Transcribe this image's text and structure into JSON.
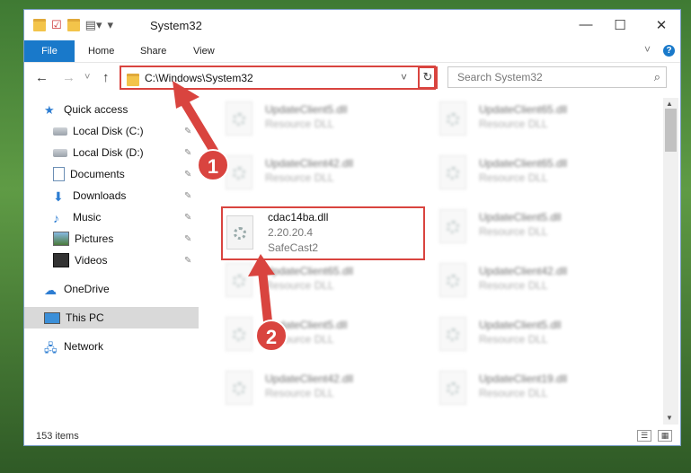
{
  "window": {
    "title": "System32",
    "controls": {
      "minimize": "—",
      "maximize": "☐",
      "close": "✕"
    }
  },
  "ribbon": {
    "tabs": [
      "File",
      "Home",
      "Share",
      "View"
    ],
    "collapse": "˅",
    "help": "?"
  },
  "nav": {
    "back": "←",
    "forward": "→",
    "recent": "˅",
    "up": "↑"
  },
  "address": {
    "path": "C:\\Windows\\System32",
    "dropdown": "˅",
    "refresh": "↻"
  },
  "search": {
    "placeholder": "Search System32",
    "icon": "⌕"
  },
  "sidebar": {
    "items": [
      {
        "label": "Quick access",
        "icon": "star-icon",
        "pinned": false
      },
      {
        "label": "Local Disk (C:)",
        "icon": "drive-icon",
        "pinned": true
      },
      {
        "label": "Local Disk (D:)",
        "icon": "drive-icon",
        "pinned": true
      },
      {
        "label": "Documents",
        "icon": "documents-icon",
        "pinned": true
      },
      {
        "label": "Downloads",
        "icon": "download-icon",
        "pinned": true
      },
      {
        "label": "Music",
        "icon": "music-icon",
        "pinned": true
      },
      {
        "label": "Pictures",
        "icon": "pictures-icon",
        "pinned": true
      },
      {
        "label": "Videos",
        "icon": "videos-icon",
        "pinned": true
      },
      {
        "label": "OneDrive",
        "icon": "cloud-icon",
        "pinned": false
      },
      {
        "label": "This PC",
        "icon": "computer-icon",
        "pinned": false,
        "selected": true
      },
      {
        "label": "Network",
        "icon": "network-icon",
        "pinned": false
      }
    ],
    "pin_glyph": "📌"
  },
  "files": [
    {
      "name": "UpdateClient5.dll",
      "type": "Resource DLL",
      "blurred": true
    },
    {
      "name": "UpdateClient65.dll",
      "type": "Resource DLL",
      "blurred": true
    },
    {
      "name": "UpdateClient42.dll",
      "type": "Resource DLL",
      "blurred": true
    },
    {
      "name": "UpdateClient65.dll",
      "type": "Resource DLL",
      "blurred": true
    },
    {
      "name": "cdac14ba.dll",
      "version": "2.20.20.4",
      "company": "SafeCast2",
      "highlighted": true
    },
    {
      "name": "UpdateClient5.dll",
      "type": "Resource DLL",
      "blurred": true
    },
    {
      "name": "UpdateClient65.dll",
      "type": "Resource DLL",
      "blurred": true
    },
    {
      "name": "UpdateClient42.dll",
      "type": "Resource DLL",
      "blurred": true
    },
    {
      "name": "UpdateClient5.dll",
      "type": "Resource DLL",
      "blurred": true
    },
    {
      "name": "UpdateClient5.dll",
      "type": "Resource DLL",
      "blurred": true
    },
    {
      "name": "UpdateClient42.dll",
      "type": "Resource DLL",
      "blurred": true
    },
    {
      "name": "UpdateClient19.dll",
      "type": "Resource DLL",
      "blurred": true
    }
  ],
  "status": {
    "count": "153 items"
  },
  "callouts": [
    "1",
    "2"
  ],
  "colors": {
    "accent": "#1979ca",
    "highlight": "#d9443f"
  }
}
